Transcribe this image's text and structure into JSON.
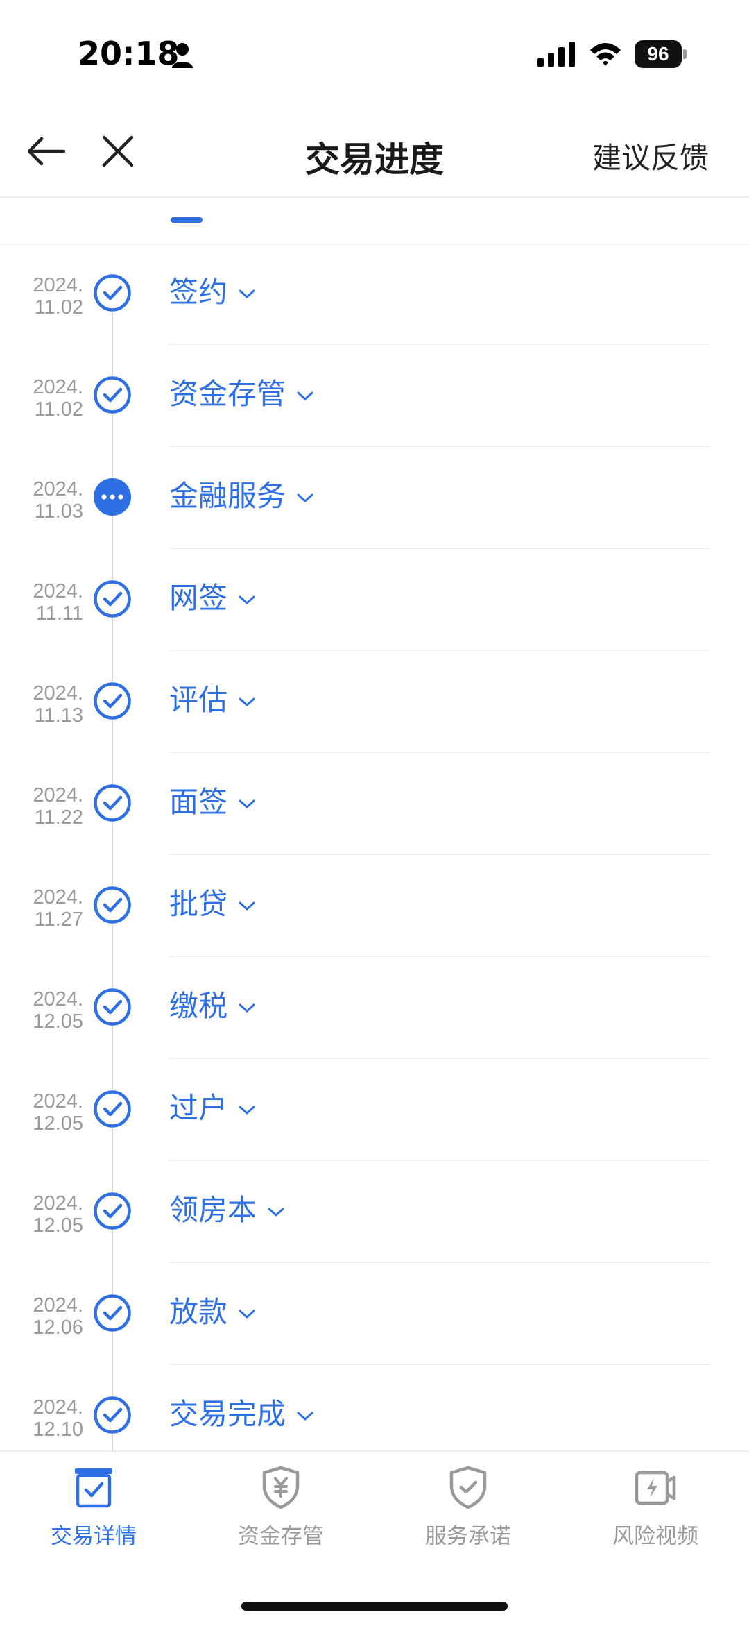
{
  "status_bar": {
    "time": "20:18",
    "battery": "96"
  },
  "nav": {
    "title": "交易进度",
    "feedback_label": "建议反馈"
  },
  "colors": {
    "accent": "#2f6fe4",
    "muted": "#999999",
    "date": "#9a9a9a"
  },
  "steps": [
    {
      "date_year": "2024.",
      "date_md": "11.02",
      "label": "签约",
      "status": "done"
    },
    {
      "date_year": "2024.",
      "date_md": "11.02",
      "label": "资金存管",
      "status": "done"
    },
    {
      "date_year": "2024.",
      "date_md": "11.03",
      "label": "金融服务",
      "status": "in-progress"
    },
    {
      "date_year": "2024.",
      "date_md": "11.11",
      "label": "网签",
      "status": "done"
    },
    {
      "date_year": "2024.",
      "date_md": "11.13",
      "label": "评估",
      "status": "done"
    },
    {
      "date_year": "2024.",
      "date_md": "11.22",
      "label": "面签",
      "status": "done"
    },
    {
      "date_year": "2024.",
      "date_md": "11.27",
      "label": "批贷",
      "status": "done"
    },
    {
      "date_year": "2024.",
      "date_md": "12.05",
      "label": "缴税",
      "status": "done"
    },
    {
      "date_year": "2024.",
      "date_md": "12.05",
      "label": "过户",
      "status": "done"
    },
    {
      "date_year": "2024.",
      "date_md": "12.05",
      "label": "领房本",
      "status": "done"
    },
    {
      "date_year": "2024.",
      "date_md": "12.06",
      "label": "放款",
      "status": "done"
    },
    {
      "date_year": "2024.",
      "date_md": "12.10",
      "label": "交易完成",
      "status": "done"
    }
  ],
  "bottom_tabs": [
    {
      "label": "交易详情",
      "icon": "transaction-detail-icon",
      "active": true
    },
    {
      "label": "资金存管",
      "icon": "fund-custody-shield-icon",
      "active": false
    },
    {
      "label": "服务承诺",
      "icon": "service-promise-shield-icon",
      "active": false
    },
    {
      "label": "风险视频",
      "icon": "risk-video-icon",
      "active": false
    }
  ]
}
